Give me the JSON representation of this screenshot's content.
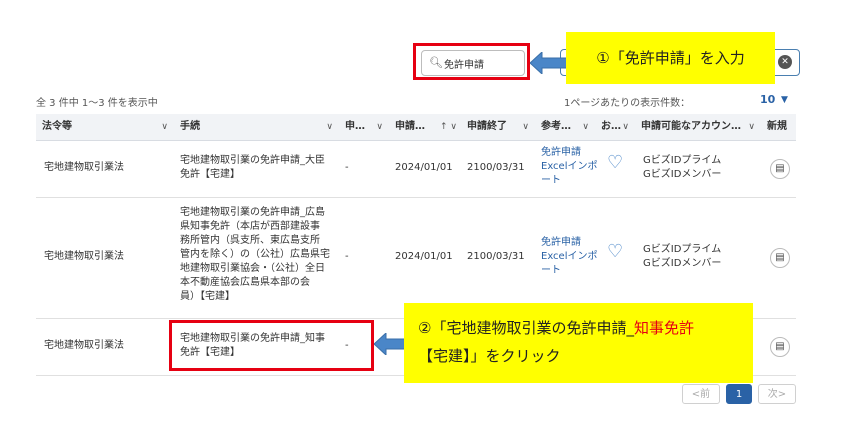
{
  "search": {
    "value": "免許申請",
    "placeholder": ""
  },
  "callouts": {
    "step1": "①「免許申請」を入力",
    "step2_prefix": "②「宅地建物取引業の免許申請_",
    "step2_highlight": "知事免許",
    "step2_suffix": "【宅建】」をクリック"
  },
  "summary": {
    "result_count": "全 3 件中 1～3 件を表示中",
    "per_page_label": "1ページあたりの表示件数：",
    "per_page_value": "10"
  },
  "table": {
    "columns": [
      "法令等",
      "手続",
      "申…",
      "申請…",
      "申請終了",
      "参考…",
      "お…",
      "申請可能なアカウン…",
      "新規"
    ],
    "rows": [
      {
        "law": "宅地建物取引業法",
        "procedure": [
          "宅地建物取引業の免許申請_大臣",
          "免許【宅建】"
        ],
        "applicant": "-",
        "start": "2024/01/01",
        "end": "2100/03/31",
        "reference": [
          "免許申請",
          "Excelインポ",
          "ート"
        ],
        "accounts": [
          "GビズIDプライム",
          "GビズIDメンバー"
        ]
      },
      {
        "law": "宅地建物取引業法",
        "procedure": [
          "宅地建物取引業の免許申請_広島",
          "県知事免許（本店が西部建設事",
          "務所管内（呉支所、東広島支所",
          "管内を除く）の（公社）広島県宅",
          "地建物取引業協会・（公社）全日",
          "本不動産協会広島県本部の会",
          "員）【宅建】"
        ],
        "applicant": "-",
        "start": "2024/01/01",
        "end": "2100/03/31",
        "reference": [
          "免許申請",
          "Excelインポ",
          "ート"
        ],
        "accounts": [
          "GビズIDプライム",
          "GビズIDメンバー"
        ]
      },
      {
        "law": "宅地建物取引業法",
        "procedure": [
          "宅地建物取引業の免許申請_知事",
          "免許【宅建】"
        ],
        "applicant": "-"
      }
    ]
  },
  "pagination": {
    "prev": "<前",
    "current": "1",
    "next": "次>"
  },
  "colors": {
    "accent": "#2a62a6",
    "highlight_red": "#e60012",
    "callout_yellow": "#ffff00"
  }
}
